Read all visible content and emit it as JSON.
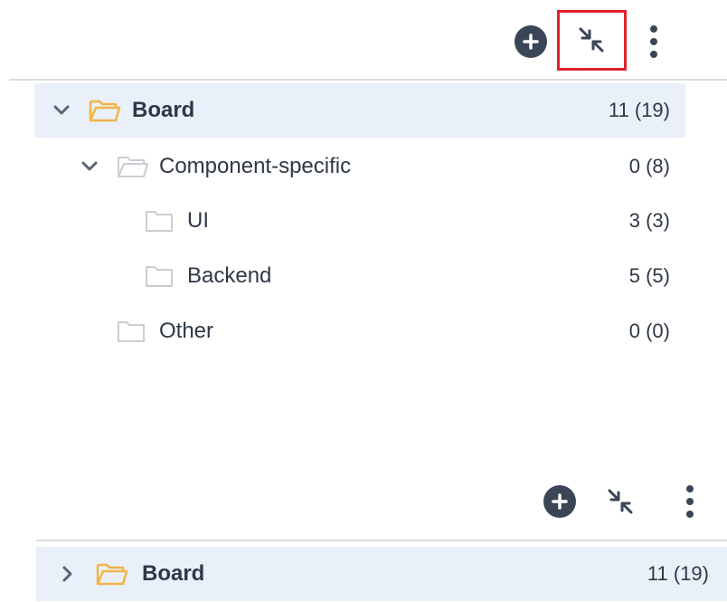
{
  "top_panel": {
    "toolbar": {
      "add_icon": "plus-circle-icon",
      "collapse_icon": "collapse-arrows-icon",
      "more_icon": "vertical-dots-icon"
    },
    "tree": [
      {
        "label": "Board",
        "count": "11 (19)"
      },
      {
        "label": "Component-specific",
        "count": "0 (8)"
      },
      {
        "label": "UI",
        "count": "3 (3)"
      },
      {
        "label": "Backend",
        "count": "5 (5)"
      },
      {
        "label": "Other",
        "count": "0 (0)"
      }
    ]
  },
  "bottom_panel": {
    "toolbar": {
      "add_icon": "plus-circle-icon",
      "collapse_icon": "collapse-arrows-icon",
      "more_icon": "vertical-dots-icon"
    },
    "tree": [
      {
        "label": "Board",
        "count": "11 (19)"
      }
    ]
  },
  "colors": {
    "accent_folder": "#f2b445",
    "selected_bg": "#e9f0f9",
    "bold_label": "#3a67a8",
    "highlight": "#e0202a"
  }
}
